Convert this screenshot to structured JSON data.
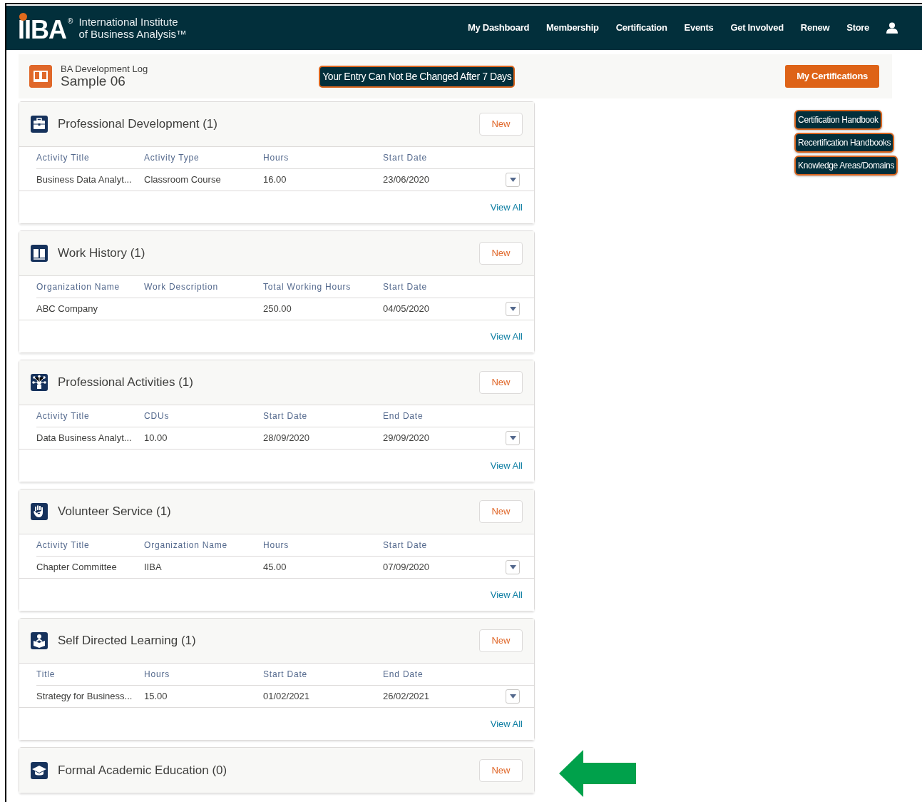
{
  "navbar": {
    "logo_text": "IIBA",
    "logo_mark": "®",
    "org_name_line1": "International Institute",
    "org_name_line2": "of Business Analysis™",
    "links": [
      "My Dashboard",
      "Membership",
      "Certification",
      "Events",
      "Get Involved",
      "Renew",
      "Store"
    ]
  },
  "header": {
    "subtitle": "BA Development Log",
    "title": "Sample 06",
    "notice": "Your Entry Can Not Be Changed After 7 Days",
    "button": "My Certifications"
  },
  "sections": [
    {
      "title": "Professional Development (1)",
      "new_button": "New",
      "columns": [
        "Activity Title",
        "Activity Type",
        "Hours",
        "Start Date"
      ],
      "rows": [
        [
          "Business Data Analyt...",
          "Classroom Course",
          "16.00",
          "23/06/2020"
        ]
      ],
      "view_all": "View All"
    },
    {
      "title": "Work History (1)",
      "new_button": "New",
      "columns": [
        "Organization Name",
        "Work Description",
        "Total Working Hours",
        "Start Date"
      ],
      "rows": [
        [
          "ABC Company",
          "",
          "250.00",
          "04/05/2020"
        ]
      ],
      "view_all": "View All"
    },
    {
      "title": "Professional Activities (1)",
      "new_button": "New",
      "columns": [
        "Activity Title",
        "CDUs",
        "Start Date",
        "End Date"
      ],
      "rows": [
        [
          "Data Business Analyt...",
          "10.00",
          "28/09/2020",
          "29/09/2020"
        ]
      ],
      "view_all": "View All"
    },
    {
      "title": "Volunteer Service (1)",
      "new_button": "New",
      "columns": [
        "Activity Title",
        "Organization Name",
        "Hours",
        "Start Date"
      ],
      "rows": [
        [
          "Chapter Committee",
          "IIBA",
          "45.00",
          "07/09/2020"
        ]
      ],
      "view_all": "View All"
    },
    {
      "title": "Self Directed Learning (1)",
      "new_button": "New",
      "columns": [
        "Title",
        "Hours",
        "Start Date",
        "End Date"
      ],
      "rows": [
        [
          "Strategy for Business...",
          "15.00",
          "01/02/2021",
          "26/02/2021"
        ]
      ],
      "view_all": "View All"
    },
    {
      "title": "Formal Academic Education (0)",
      "new_button": "New"
    }
  ],
  "side_links": [
    "Certification Handbook",
    "Recertification Handbooks",
    "Knowledge Areas/Domains"
  ]
}
